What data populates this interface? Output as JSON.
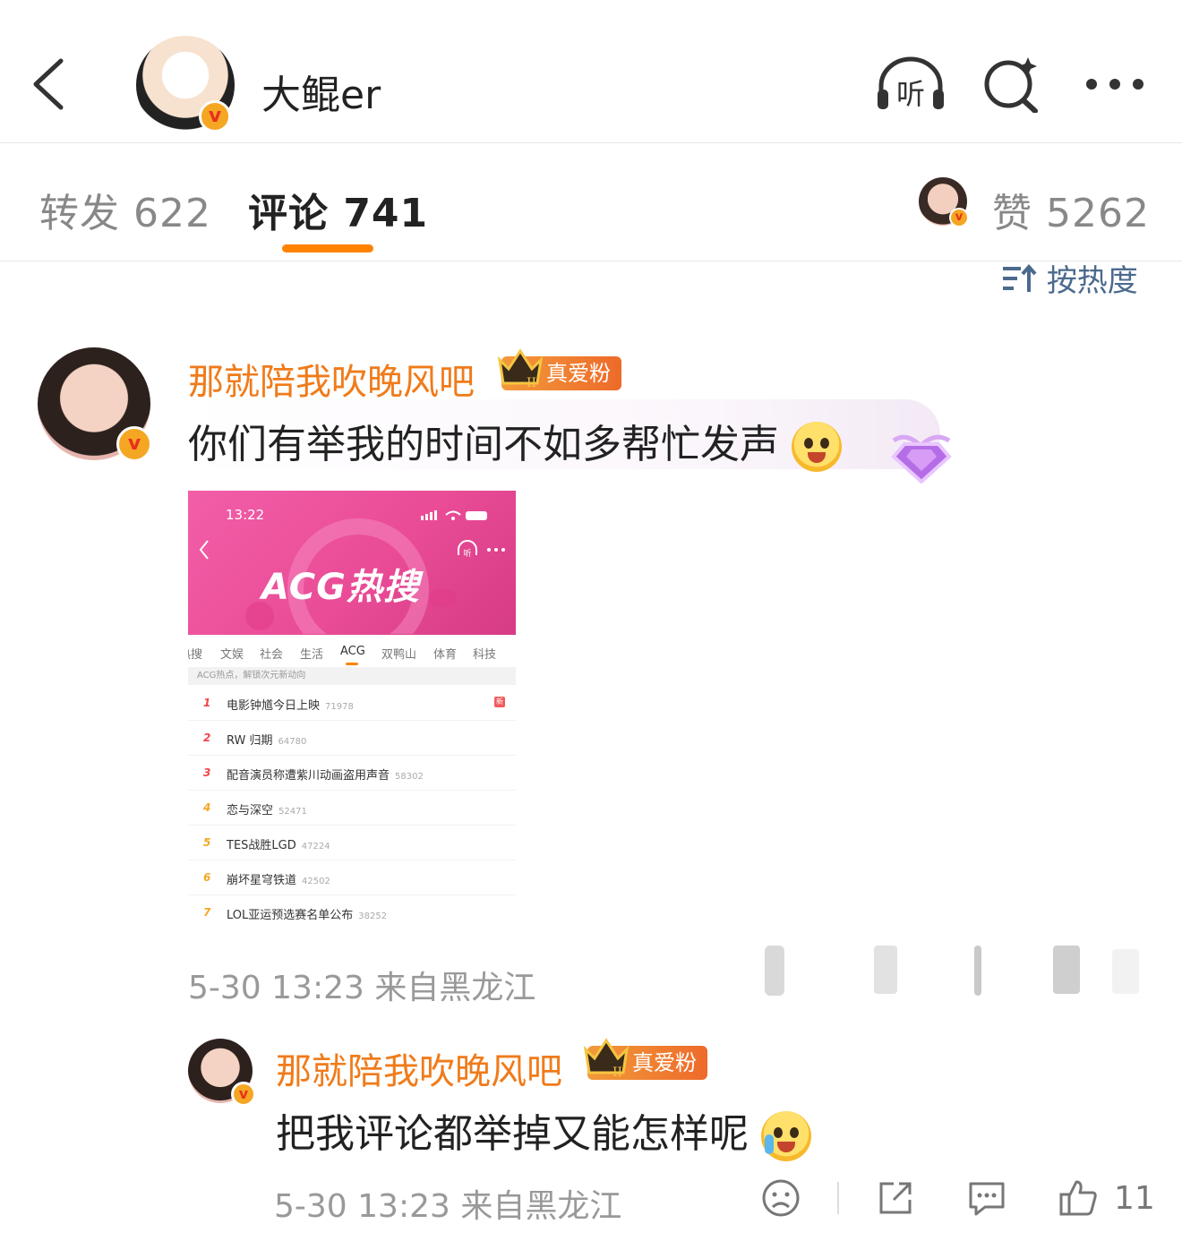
{
  "header": {
    "title": "大鲲er",
    "back_icon": "chevron-left-icon",
    "listen_icon": "headphones-listen-icon",
    "listen_label": "听",
    "search_icon": "search-sparkle-icon",
    "more_icon": "more-dots-icon"
  },
  "tabs": {
    "repost": "转发 622",
    "comment": "评论 741",
    "like": "赞 5262"
  },
  "sort_label": "按热度",
  "comment": {
    "username": "那就陪我吹晚风吧",
    "fan_badge": "真爱粉",
    "fan_level": "II",
    "text": "你们有举我的时间不如多帮忙发声",
    "meta": "5-30 13:23 来自黑龙江",
    "screenshot": {
      "time": "13:22",
      "title": "ACG热搜",
      "listen_label": "听",
      "nav": [
        "热搜",
        "文娱",
        "社会",
        "生活",
        "ACG",
        "双鸭山",
        "体育",
        "科技"
      ],
      "active_nav": "ACG",
      "subtitle": "ACG热点，解锁次元新动向",
      "items": [
        {
          "rank": "1",
          "title": "电影钟馗今日上映",
          "count": "71978",
          "tag": "新"
        },
        {
          "rank": "2",
          "title": "RW 归期",
          "count": "64780",
          "tag": ""
        },
        {
          "rank": "3",
          "title": "配音演员称遭紫川动画盗用声音",
          "count": "58302",
          "tag": ""
        },
        {
          "rank": "4",
          "title": "恋与深空",
          "count": "52471",
          "tag": ""
        },
        {
          "rank": "5",
          "title": "TES战胜LGD",
          "count": "47224",
          "tag": ""
        },
        {
          "rank": "6",
          "title": "崩坏星穹铁道",
          "count": "42502",
          "tag": ""
        },
        {
          "rank": "7",
          "title": "LOL亚运预选赛名单公布",
          "count": "38252",
          "tag": ""
        }
      ]
    }
  },
  "reply": {
    "username": "那就陪我吹晚风吧",
    "fan_badge": "真爱粉",
    "fan_level": "II",
    "text": "把我评论都举掉又能怎样呢",
    "meta": "5-30 13:23 来自黑龙江",
    "like_count": "11"
  },
  "colors": {
    "accent": "#ff8200",
    "username": "#f07b1a",
    "sort": "#4b6a8d",
    "hot_pink": "#ea4c97"
  }
}
